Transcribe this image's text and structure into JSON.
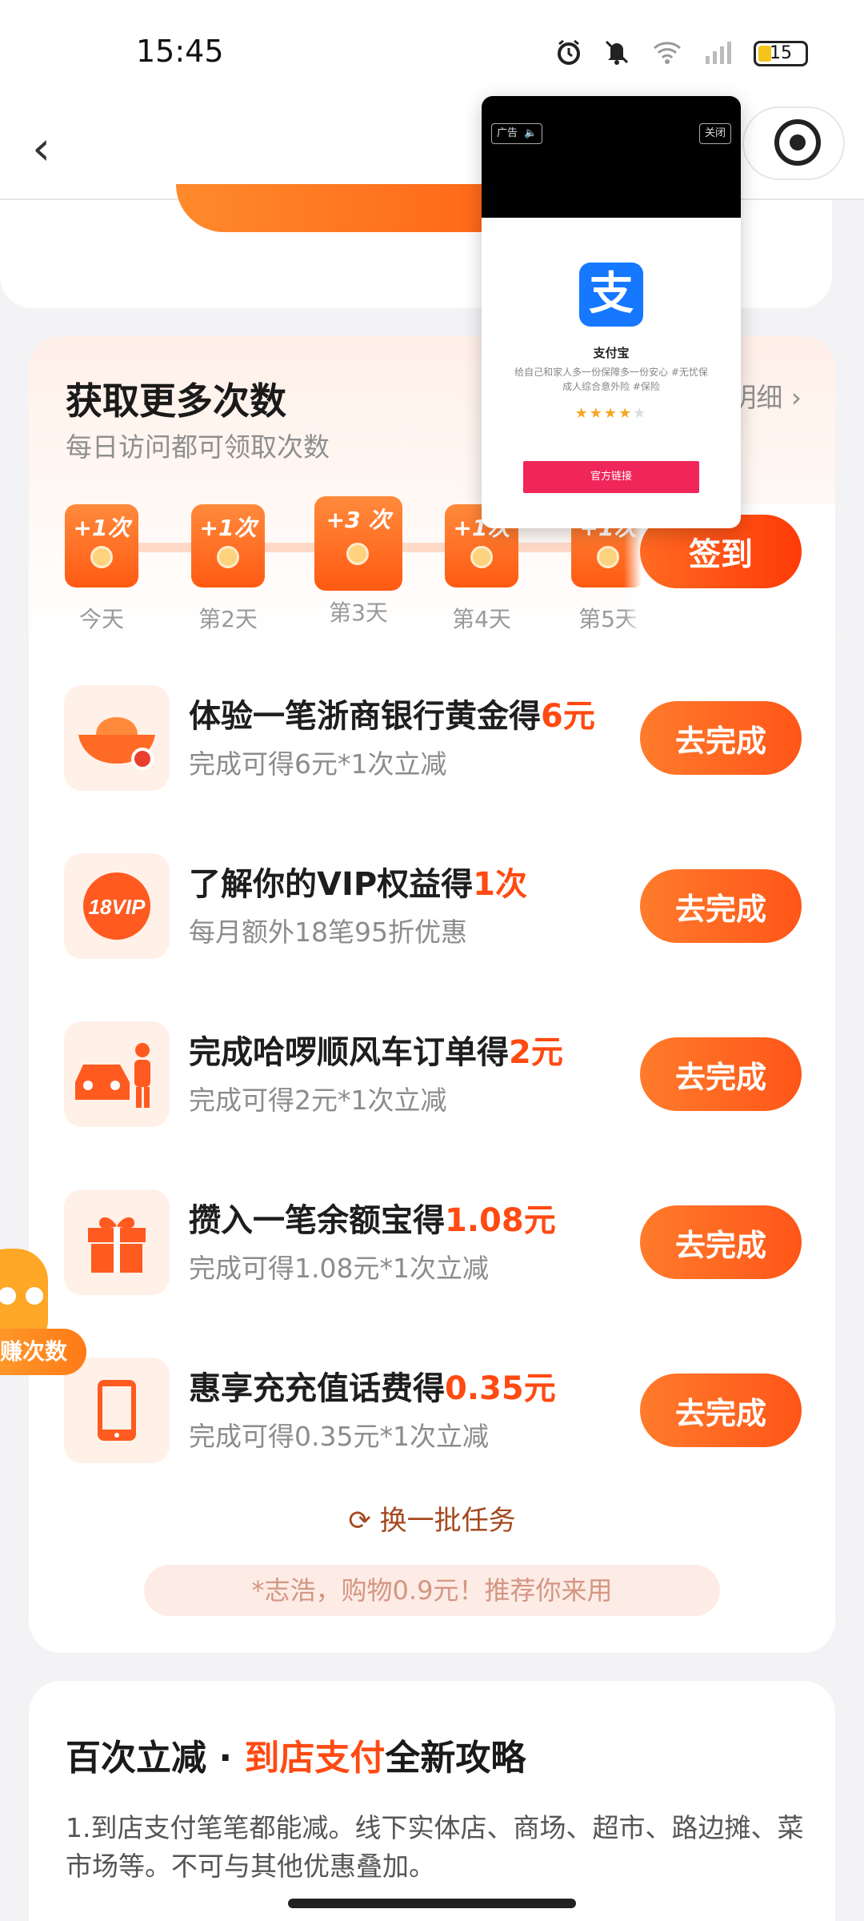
{
  "status_bar": {
    "time": "15:45",
    "battery": "15"
  },
  "nav": {
    "back": "‹"
  },
  "more_times": {
    "title": "获取更多次数",
    "subtitle": "每日访问都可领取次数",
    "detail_link": "明细 ›",
    "signin_label": "签到",
    "days": [
      {
        "reward": "+1次",
        "label": "今天"
      },
      {
        "reward": "+1次",
        "label": "第2天"
      },
      {
        "reward": "+3 次",
        "label": "第3天"
      },
      {
        "reward": "+1次",
        "label": "第4天"
      },
      {
        "reward": "+1次",
        "label": "第5天"
      }
    ]
  },
  "tasks": [
    {
      "title": "体验一笔浙商银行黄金得",
      "highlight": "6元",
      "subtitle": "完成可得6元*1次立减",
      "button": "去完成",
      "icon": "gold-ingot-icon"
    },
    {
      "title": "了解你的VIP权益得",
      "highlight": "1次",
      "subtitle": "每月额外18笔95折优惠",
      "button": "去完成",
      "icon": "vip-badge-icon",
      "icon_text": "18VIP"
    },
    {
      "title": "完成哈啰顺风车订单得",
      "highlight": "2元",
      "subtitle": "完成可得2元*1次立减",
      "button": "去完成",
      "icon": "car-passenger-icon"
    },
    {
      "title": "攒入一笔余额宝得",
      "highlight": "1.08元",
      "subtitle": "完成可得1.08元*1次立减",
      "button": "去完成",
      "icon": "gift-box-icon"
    },
    {
      "title": "惠享充充值话费得",
      "highlight": "0.35元",
      "subtitle": "完成可得0.35元*1次立减",
      "button": "去完成",
      "icon": "phone-icon"
    }
  ],
  "refresh_label": "换一批任务",
  "promo_text": "*志浩，购物0.9元！推荐你来用",
  "bottom": {
    "title_pre": "百次立减 · ",
    "title_hl": "到店支付",
    "title_post": "全新攻略",
    "text": "1.到店支付笔笔都能减。线下实体店、商场、超市、路边摊、菜市场等。不可与其他优惠叠加。"
  },
  "floating_badge": "赚次数",
  "ad": {
    "tag": "广告",
    "close": "关闭",
    "logo_char": "支",
    "name": "支付宝",
    "desc": "给自己和家人多一份保障多一份安心 #无忧保成人综合意外险 #保险",
    "stars": "★★★★",
    "star_off": "★",
    "button": "官方链接"
  },
  "colors": {
    "accent": "#ff5a12",
    "highlight": "#ff4a12",
    "ad_button": "#f0265b",
    "alipay_blue": "#1677ff"
  }
}
